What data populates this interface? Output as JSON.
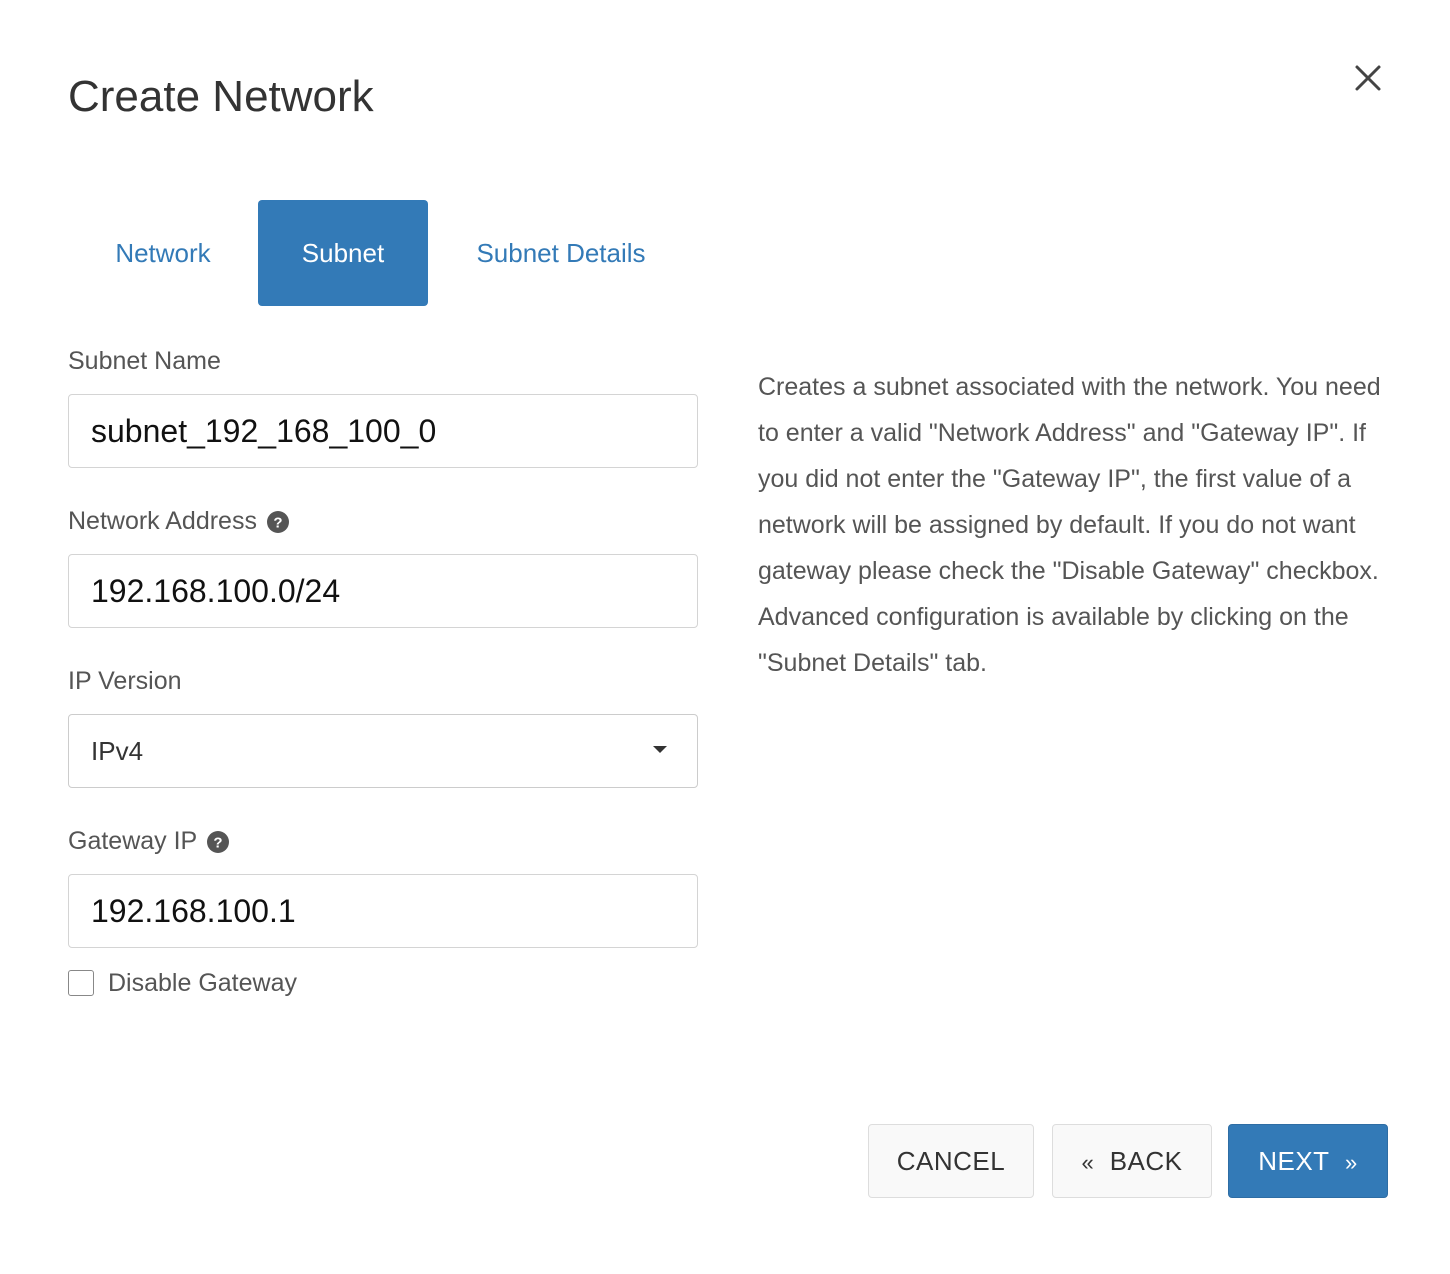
{
  "dialog": {
    "title": "Create Network",
    "close_icon": "close-icon"
  },
  "tabs": [
    {
      "label": "Network",
      "active": false
    },
    {
      "label": "Subnet",
      "active": true
    },
    {
      "label": "Subnet Details",
      "active": false
    }
  ],
  "form": {
    "subnet_name": {
      "label": "Subnet Name",
      "value": "subnet_192_168_100_0"
    },
    "network_address": {
      "label": "Network Address",
      "value": "192.168.100.0/24",
      "help_icon": "question-circle-icon"
    },
    "ip_version": {
      "label": "IP Version",
      "value": "IPv4"
    },
    "gateway_ip": {
      "label": "Gateway IP",
      "value": "192.168.100.1",
      "help_icon": "question-circle-icon"
    },
    "disable_gateway": {
      "label": "Disable Gateway",
      "checked": false
    }
  },
  "description": "Creates a subnet associated with the network. You need to enter a valid \"Network Address\" and \"Gateway IP\". If you did not enter the \"Gateway IP\", the first value of a network will be assigned by default. If you do not want gateway please check the \"Disable Gateway\" checkbox. Advanced configuration is available by clicking on the \"Subnet Details\" tab.",
  "footer": {
    "cancel_label": "CANCEL",
    "back_label": "BACK",
    "back_icon": "«",
    "next_label": "NEXT",
    "next_icon": "»"
  },
  "colors": {
    "primary": "#337ab7",
    "text": "#333333",
    "muted": "#555555"
  }
}
